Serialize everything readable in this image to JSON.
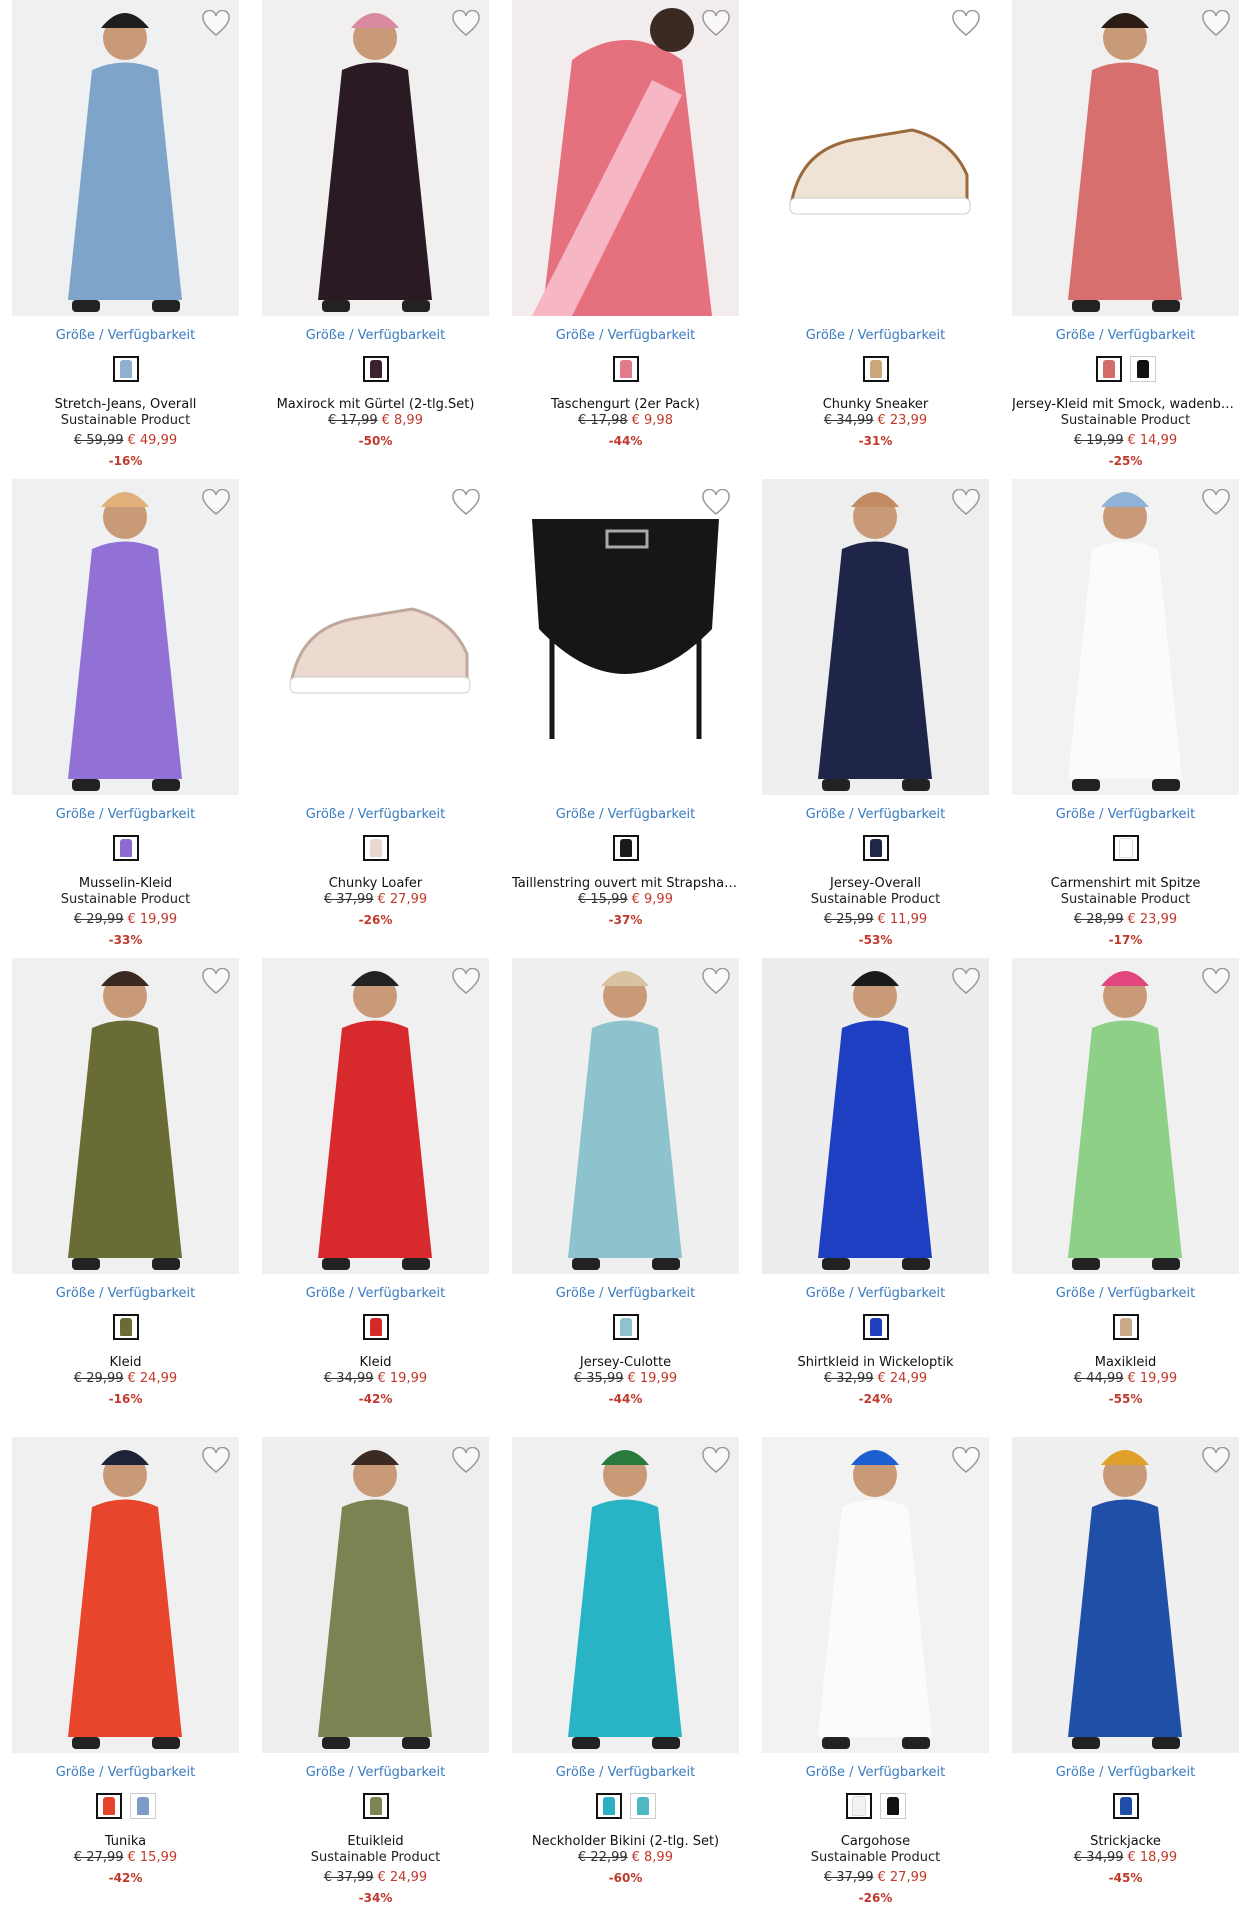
{
  "accent": "#3a7bbf",
  "sale_color": "#c0392b",
  "availability_label": "Größe / Verfügbarkeit",
  "products": [
    {
      "title": "Stretch-Jeans, Overall",
      "sustainable": "Sustainable Product",
      "old_price": "€ 59,99",
      "new_price": "€ 49,99",
      "discount": "-16%",
      "swatches": [
        "#8fb0cf"
      ],
      "img": {
        "bg": "#eef0f2",
        "main": "#7fa4c9",
        "accent": "#1e1e1e"
      }
    },
    {
      "title": "Maxirock mit Gürtel (2-tlg.Set)",
      "sustainable": "",
      "old_price": "€ 17,99",
      "new_price": "€ 8,99",
      "discount": "-50%",
      "swatches": [
        "#3b2230"
      ],
      "img": {
        "bg": "#f1f0ef",
        "main": "#2a1a24",
        "accent": "#d98aa0"
      }
    },
    {
      "title": "Taschengurt (2er Pack)",
      "sustainable": "",
      "old_price": "€ 17,98",
      "new_price": "€ 9,98",
      "discount": "-44%",
      "swatches": [
        "#e07a8c"
      ],
      "img": {
        "bg": "#f3ecec",
        "main": "#e5707e",
        "accent": "#f7b6c4"
      }
    },
    {
      "title": "Chunky Sneaker",
      "sustainable": "",
      "old_price": "€ 34,99",
      "new_price": "€ 23,99",
      "discount": "-31%",
      "swatches": [
        "#c9a77a"
      ],
      "img": {
        "bg": "#ffffff",
        "main": "#efe3d5",
        "accent": "#9a6a3c"
      }
    },
    {
      "title": "Jersey-Kleid mit Smock, wadenbedeckt",
      "sustainable": "Sustainable Product",
      "old_price": "€ 19,99",
      "new_price": "€ 14,99",
      "discount": "-25%",
      "swatches": [
        "#d46b6b",
        "#111111"
      ],
      "img": {
        "bg": "#f0f0f0",
        "main": "#d86f6f",
        "accent": "#2b1d16"
      }
    },
    {
      "title": "Musselin-Kleid",
      "sustainable": "Sustainable Product",
      "old_price": "€ 29,99",
      "new_price": "€ 19,99",
      "discount": "-33%",
      "swatches": [
        "#8d6ad0"
      ],
      "img": {
        "bg": "#eef0f1",
        "main": "#9171d6",
        "accent": "#e2b07a"
      }
    },
    {
      "title": "Chunky Loafer",
      "sustainable": "",
      "old_price": "€ 37,99",
      "new_price": "€ 27,99",
      "discount": "-26%",
      "swatches": [
        "#e9d8cf"
      ],
      "img": {
        "bg": "#ffffff",
        "main": "#ecd9cf",
        "accent": "#bfa99c"
      }
    },
    {
      "title": "Taillenstring ouvert mit Strapshalter",
      "sustainable": "",
      "old_price": "€ 15,99",
      "new_price": "€ 9,99",
      "discount": "-37%",
      "swatches": [
        "#1a1a1a"
      ],
      "img": {
        "bg": "#ffffff",
        "main": "#161616",
        "accent": "#444444"
      }
    },
    {
      "title": "Jersey-Overall",
      "sustainable": "Sustainable Product",
      "old_price": "€ 25,99",
      "new_price": "€ 11,99",
      "discount": "-53%",
      "swatches": [
        "#1f2747"
      ],
      "img": {
        "bg": "#eeeeee",
        "main": "#1e2548",
        "accent": "#c28b63"
      }
    },
    {
      "title": "Carmenshirt mit Spitze",
      "sustainable": "Sustainable Product",
      "old_price": "€ 28,99",
      "new_price": "€ 23,99",
      "discount": "-17%",
      "swatches": [
        "#ffffff"
      ],
      "img": {
        "bg": "#f2f2f2",
        "main": "#fbfbfb",
        "accent": "#8fb3d6"
      }
    },
    {
      "title": "Kleid",
      "sustainable": "",
      "old_price": "€ 29,99",
      "new_price": "€ 24,99",
      "discount": "-16%",
      "swatches": [
        "#6b6b34"
      ],
      "img": {
        "bg": "#f0f0f0",
        "main": "#6a6c35",
        "accent": "#3a2a22"
      }
    },
    {
      "title": "Kleid",
      "sustainable": "",
      "old_price": "€ 34,99",
      "new_price": "€ 19,99",
      "discount": "-42%",
      "swatches": [
        "#d42a2a"
      ],
      "img": {
        "bg": "#f0f0f0",
        "main": "#d8292d",
        "accent": "#222222"
      }
    },
    {
      "title": "Jersey-Culotte",
      "sustainable": "",
      "old_price": "€ 35,99",
      "new_price": "€ 19,99",
      "discount": "-44%",
      "swatches": [
        "#8fc2cc"
      ],
      "img": {
        "bg": "#efefef",
        "main": "#8cc3cd",
        "accent": "#d8c3a0"
      }
    },
    {
      "title": "Shirtkleid in Wickeloptik",
      "sustainable": "",
      "old_price": "€ 32,99",
      "new_price": "€ 24,99",
      "discount": "-24%",
      "swatches": [
        "#1f3fbf"
      ],
      "img": {
        "bg": "#ededed",
        "main": "#1f3fc2",
        "accent": "#1a1a1a"
      }
    },
    {
      "title": "Maxikleid",
      "sustainable": "",
      "old_price": "€ 44,99",
      "new_price": "€ 19,99",
      "discount": "-55%",
      "swatches": [
        "#c9a98a"
      ],
      "img": {
        "bg": "#f0f0f0",
        "main": "#8fd089",
        "accent": "#e2467e"
      }
    },
    {
      "title": "Tunika",
      "sustainable": "",
      "old_price": "€ 27,99",
      "new_price": "€ 15,99",
      "discount": "-42%",
      "swatches": [
        "#e5432a",
        "#7d9cc8"
      ],
      "img": {
        "bg": "#f0f0f0",
        "main": "#e8462c",
        "accent": "#1e2338"
      }
    },
    {
      "title": "Etuikleid",
      "sustainable": "Sustainable Product",
      "old_price": "€ 37,99",
      "new_price": "€ 24,99",
      "discount": "-34%",
      "swatches": [
        "#7b8551"
      ],
      "img": {
        "bg": "#eeeeee",
        "main": "#7a8452",
        "accent": "#3a2a22"
      }
    },
    {
      "title": "Neckholder Bikini (2-tlg. Set)",
      "sustainable": "",
      "old_price": "€ 22,99",
      "new_price": "€ 8,99",
      "discount": "-60%",
      "swatches": [
        "#2bb0c2",
        "#4fb7c4"
      ],
      "img": {
        "bg": "#f0f0f0",
        "main": "#29b4c5",
        "accent": "#2a7a3e"
      }
    },
    {
      "title": "Cargohose",
      "sustainable": "Sustainable Product",
      "old_price": "€ 37,99",
      "new_price": "€ 27,99",
      "discount": "-26%",
      "swatches": [
        "#f2f2f2",
        "#111111"
      ],
      "img": {
        "bg": "#f2f2f2",
        "main": "#fbfbfb",
        "accent": "#1b5fd0"
      }
    },
    {
      "title": "Strickjacke",
      "sustainable": "",
      "old_price": "€ 34,99",
      "new_price": "€ 18,99",
      "discount": "-45%",
      "swatches": [
        "#1f4ea8"
      ],
      "img": {
        "bg": "#efefef",
        "main": "#1f4fa6",
        "accent": "#e0a12a"
      }
    }
  ]
}
